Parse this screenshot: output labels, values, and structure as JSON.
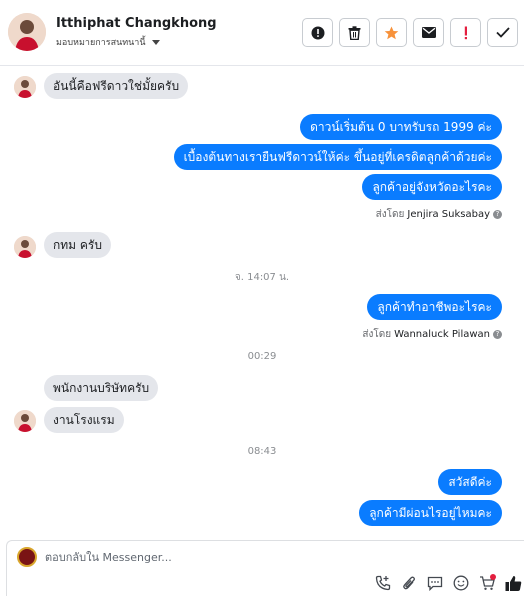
{
  "header": {
    "contact_name": "Itthiphat Changkhong",
    "assign_label": "มอบหมายการสนทนานี้"
  },
  "actions": [
    {
      "name": "mark-spam-button",
      "icon": "alert-circle-icon"
    },
    {
      "name": "delete-button",
      "icon": "trash-icon"
    },
    {
      "name": "star-button",
      "icon": "star-icon"
    },
    {
      "name": "mark-unread-button",
      "icon": "envelope-icon"
    },
    {
      "name": "follow-up-button",
      "icon": "exclamation-icon"
    },
    {
      "name": "mark-done-button",
      "icon": "check-icon"
    }
  ],
  "messages": {
    "m1": "อันนี้คือฟรีดาวใช่มั้ยครับ",
    "m2": "ดาวน์เริ่มต้น 0 บาทรับรถ 1999 ค่ะ",
    "m3": "เบื้องต้นทางเรายืนฟรีดาวน์ให้ค่ะ ขึ้นอยู่ที่เครดิตลูกค้าด้วยค่ะ",
    "m4": "ลูกค้าอยู่จังหวัดอะไรคะ",
    "sent1_prefix": "ส่งโดย",
    "sent1_name": "Jenjira Suksabay",
    "m5": "กทม ครับ",
    "time1": "จ. 14:07 น.",
    "m6": "ลูกค้าทำอาชีพอะไรคะ",
    "sent2_prefix": "ส่งโดย",
    "sent2_name": "Wannaluck Pilawan",
    "time2": "00:29",
    "m7": "พนักงานบริษัทครับ",
    "m8": "งานโรงแรม",
    "time3": "08:43",
    "m9": "สวัสดีค่ะ",
    "m10": "ลูกค้ามีผ่อนไรอยู่ไหมคะ"
  },
  "composer": {
    "placeholder": "ตอบกลับใน Messenger..."
  },
  "colors": {
    "outgoing_bubble": "#0a7cff",
    "incoming_bubble": "#e4e6eb",
    "star": "#f7923b",
    "follow_up": "#e41e3f"
  }
}
